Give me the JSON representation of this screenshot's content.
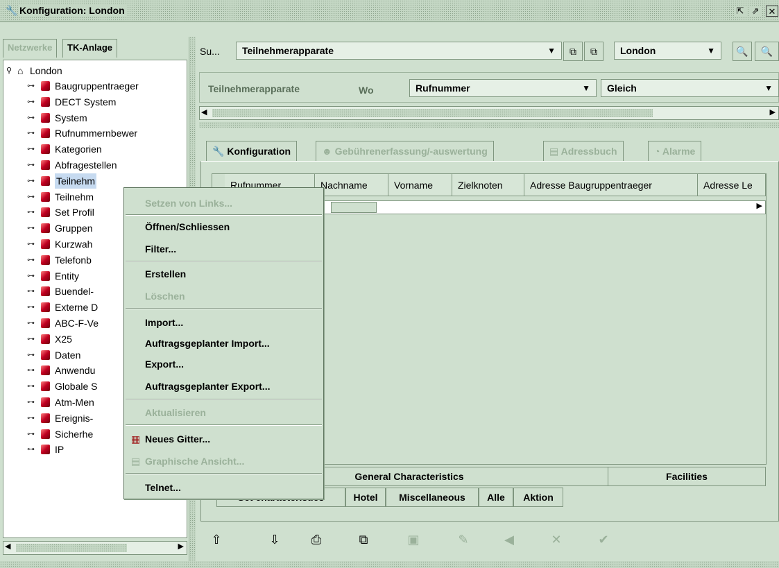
{
  "window": {
    "title": "Konfiguration: London",
    "icon": "wrench-icon"
  },
  "left_panel": {
    "tabs": [
      {
        "label": "Netzwerke",
        "active": false
      },
      {
        "label": "TK-Anlage",
        "active": true
      }
    ],
    "root": "London",
    "items": [
      "Baugruppentraeger",
      "DECT System",
      "System",
      "Rufnummernbewer",
      "Kategorien",
      "Abfragestellen",
      "Teilnehm",
      "Teilnehm",
      "Set Profil",
      "Gruppen",
      "Kurzwah",
      "Telefonb",
      "Entity",
      "Buendel-",
      "Externe D",
      "ABC-F-Ve",
      "X25",
      "Daten",
      "Anwendu",
      "Globale S",
      "Atm-Men",
      "Ereignis-",
      "Sicherhe",
      "IP"
    ]
  },
  "search_bar": {
    "label": "Su...",
    "type_value": "Teilnehmerapparate",
    "location_value": "London"
  },
  "filter_bar": {
    "object": "Teilnehmerapparate",
    "where_label": "Wo",
    "field": "Rufnummer",
    "operator": "Gleich"
  },
  "main_tabs": [
    {
      "label": "Konfiguration",
      "icon": "wrench-icon",
      "disabled": false
    },
    {
      "label": "Gebührenerfassung/-auswertung",
      "icon": "coins-icon",
      "disabled": true
    },
    {
      "label": "Adressbuch",
      "icon": "addressbook-icon",
      "disabled": true
    },
    {
      "label": "Alarme",
      "icon": "alarm-icon",
      "disabled": true
    }
  ],
  "table": {
    "columns": [
      "Rufnummer",
      "Nachname",
      "Vorname",
      "Zielknoten",
      "Adresse Baugruppentraeger",
      "Adresse Le"
    ]
  },
  "sub_tabs_row1": {
    "left": "General Characteristics",
    "right": "Facilities"
  },
  "sub_tabs_row2": [
    "Set characteristics",
    "Hotel",
    "Miscellaneous",
    "Alle",
    "Aktion"
  ],
  "context_menu": {
    "items": [
      {
        "label": "Setzen von Links...",
        "disabled": true
      },
      {
        "label": "Öffnen/Schliessen",
        "disabled": false
      },
      {
        "label": "Filter...",
        "disabled": false
      },
      {
        "label": "Erstellen",
        "disabled": false
      },
      {
        "label": "Löschen",
        "disabled": true
      },
      {
        "label": "Import...",
        "disabled": false
      },
      {
        "label": "Auftragsgeplanter Import...",
        "disabled": false
      },
      {
        "label": "Export...",
        "disabled": false
      },
      {
        "label": "Auftragsgeplanter Export...",
        "disabled": false
      },
      {
        "label": "Aktualisieren",
        "disabled": true
      },
      {
        "label": "Neues Gitter...",
        "disabled": false,
        "icon": "grid-icon"
      },
      {
        "label": "Graphische Ansicht...",
        "disabled": true,
        "icon": "chart-icon"
      },
      {
        "label": "Telnet...",
        "disabled": false
      }
    ]
  },
  "colors": {
    "background": "#cfe0cf",
    "border": "#7f967f",
    "disabled_text": "#9ab19a",
    "selection": "#c6daf0"
  }
}
